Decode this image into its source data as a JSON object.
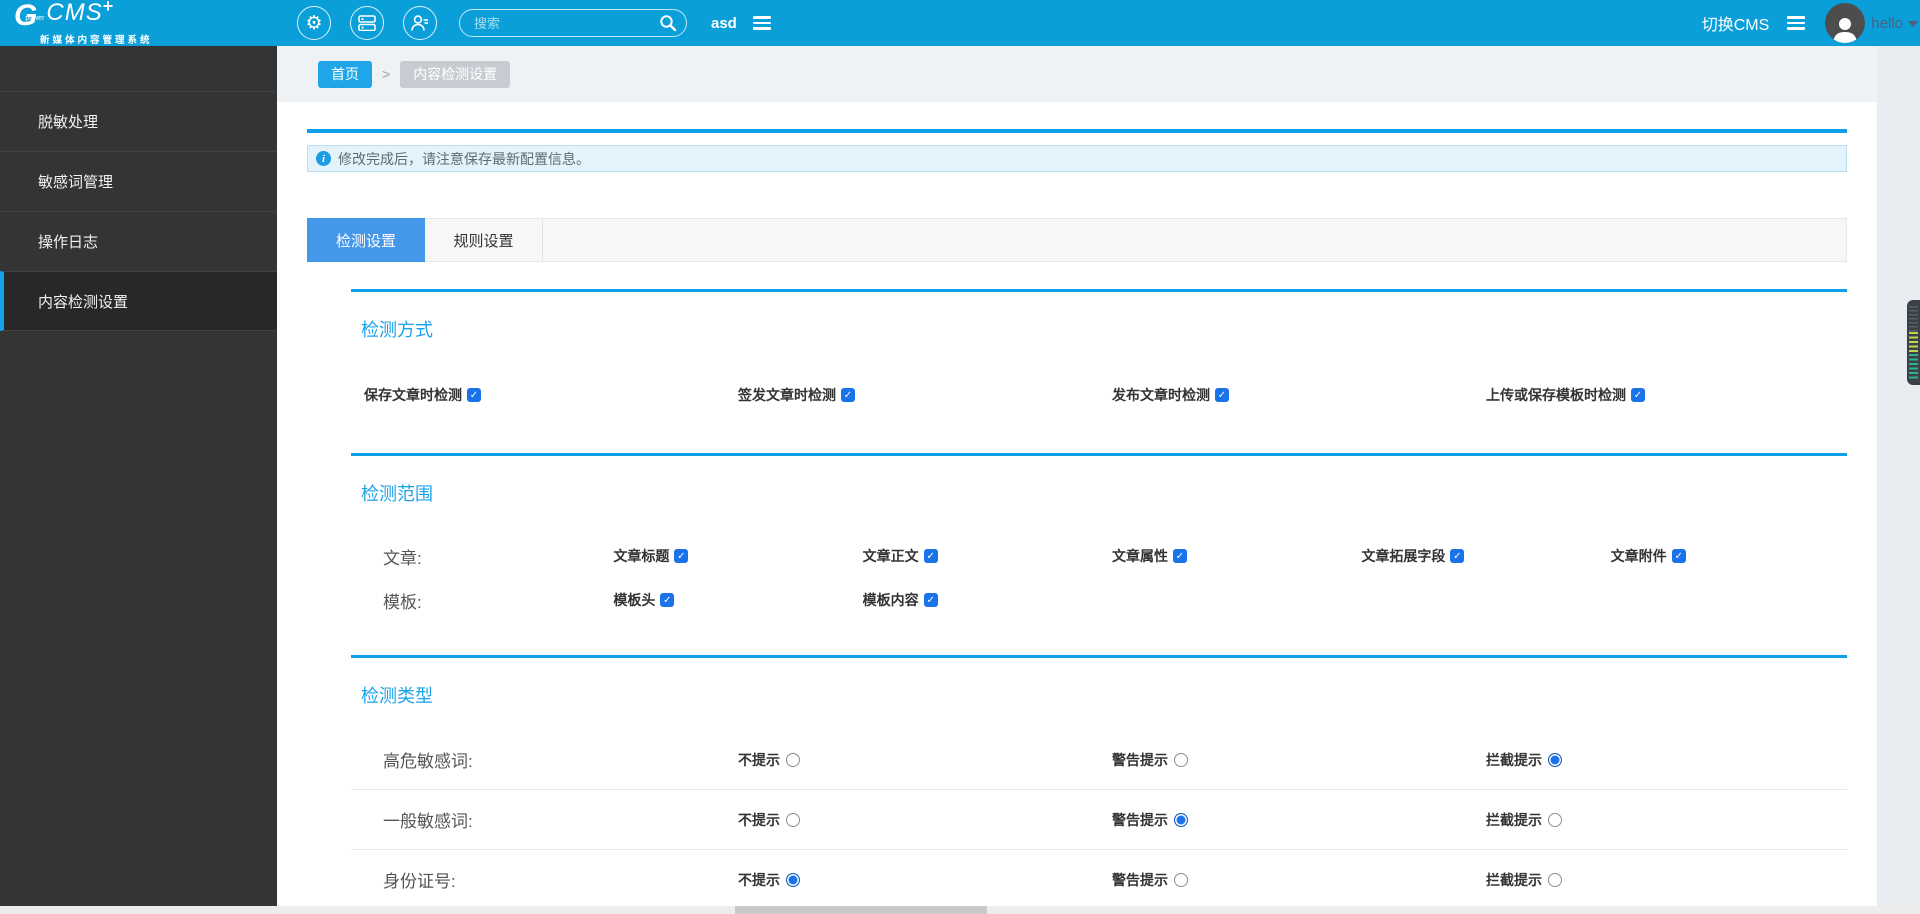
{
  "header": {
    "logo": {
      "letter": "G",
      "power": "power",
      "name": "CMS",
      "plus": "+",
      "subtitle": "新媒体内容管理系统"
    },
    "search": {
      "placeholder": "搜索"
    },
    "shortcut_text": "asd",
    "switch_cms_label": "切换CMS",
    "user_name": "hello"
  },
  "sidebar": {
    "items": [
      {
        "label": "脱敏处理",
        "active": false
      },
      {
        "label": "敏感词管理",
        "active": false
      },
      {
        "label": "操作日志",
        "active": false
      },
      {
        "label": "内容检测设置",
        "active": true
      }
    ]
  },
  "breadcrumb": {
    "home": "首页",
    "separator": ">",
    "current": "内容检测设置"
  },
  "alert": {
    "text": "修改完成后，请注意保存最新配置信息。"
  },
  "tabs": [
    {
      "label": "检测设置",
      "active": true
    },
    {
      "label": "规则设置",
      "active": false
    }
  ],
  "sections": {
    "method": {
      "title": "检测方式",
      "checkboxes": [
        {
          "label": "保存文章时检测",
          "checked": true
        },
        {
          "label": "签发文章时检测",
          "checked": true
        },
        {
          "label": "发布文章时检测",
          "checked": true
        },
        {
          "label": "上传或保存模板时检测",
          "checked": true
        }
      ]
    },
    "scope": {
      "title": "检测范围",
      "rows": [
        {
          "label": "文章:",
          "checkboxes": [
            {
              "label": "文章标题",
              "checked": true
            },
            {
              "label": "文章正文",
              "checked": true
            },
            {
              "label": "文章属性",
              "checked": true
            },
            {
              "label": "文章拓展字段",
              "checked": true
            },
            {
              "label": "文章附件",
              "checked": true
            }
          ]
        },
        {
          "label": "模板:",
          "checkboxes": [
            {
              "label": "模板头",
              "checked": true
            },
            {
              "label": "模板内容",
              "checked": true
            }
          ]
        }
      ]
    },
    "detect_type": {
      "title": "检测类型",
      "option_labels": [
        "不提示",
        "警告提示",
        "拦截提示"
      ],
      "rows": [
        {
          "label": "高危敏感词:",
          "selected": 2
        },
        {
          "label": "一般敏感词:",
          "selected": 1
        },
        {
          "label": "身份证号:",
          "selected": 0
        }
      ]
    }
  },
  "icons": {
    "check_glyph": "✓",
    "gear_glyph": "⚙"
  },
  "colors": {
    "header_bg": "#0a9fd9",
    "sidebar_bg": "#343434",
    "accent_blue": "#0f9ee8",
    "tab_active": "#4597e9",
    "crumb_home_bg": "#1ea6e9",
    "crumb_current_bg": "#c8ccd2",
    "alert_bg": "#e3f2fb",
    "checkbox_blue": "#1a73e8"
  }
}
